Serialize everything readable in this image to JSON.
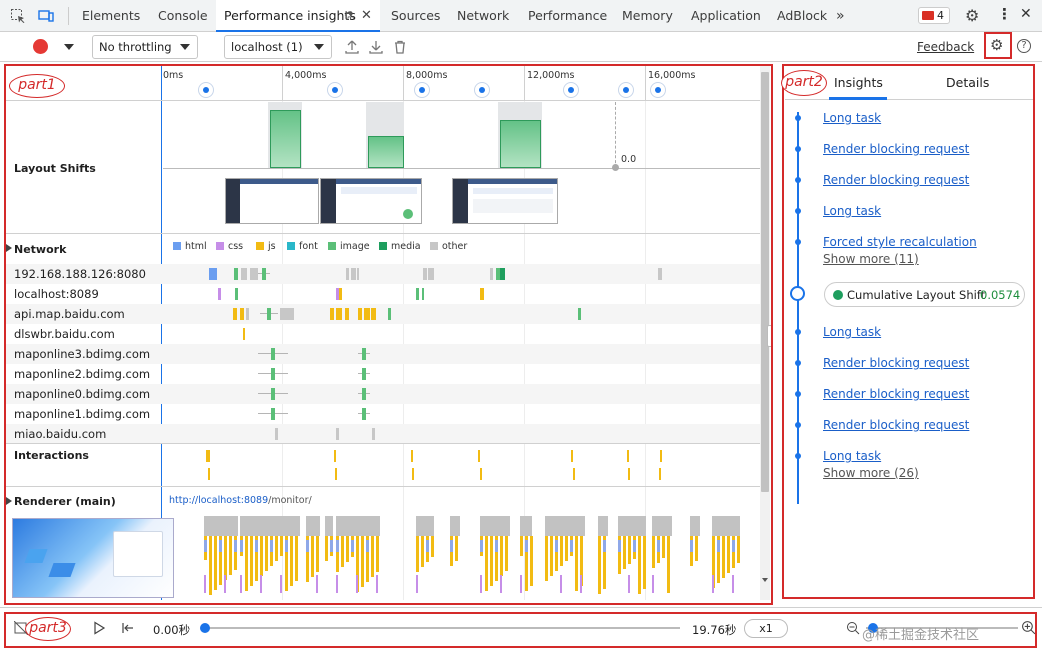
{
  "tabbar": {
    "tabs": [
      {
        "label": "Elements"
      },
      {
        "label": "Console"
      },
      {
        "label": "Performance insights"
      },
      {
        "label": "Sources"
      },
      {
        "label": "Network"
      },
      {
        "label": "Performance"
      },
      {
        "label": "Memory"
      },
      {
        "label": "Application"
      },
      {
        "label": "AdBlock"
      }
    ],
    "issues_count": "4",
    "active_tab_color": "#1a73e8"
  },
  "toolbar": {
    "throttling": "No throttling",
    "target": "localhost (1)",
    "feedback": "Feedback"
  },
  "annotations": {
    "part1": "part1",
    "part2": "part2",
    "part3": "part3",
    "color": "#d42a2a"
  },
  "timeline": {
    "ticks": [
      "0ms",
      "4,000ms",
      "8,000ms",
      "12,000ms",
      "16,000ms"
    ],
    "layout_shifts_label": "Layout Shifts",
    "layout_shift_value": "0.0",
    "network_label": "Network",
    "legend": [
      {
        "name": "html",
        "color": "#6b9ef0"
      },
      {
        "name": "css",
        "color": "#c68ee8"
      },
      {
        "name": "js",
        "color": "#f2bb13"
      },
      {
        "name": "font",
        "color": "#2ab7c9"
      },
      {
        "name": "image",
        "color": "#5bbf78"
      },
      {
        "name": "media",
        "color": "#1e9e5e"
      },
      {
        "name": "other",
        "color": "#c7c7c7"
      }
    ],
    "hosts": [
      "192.168.188.126:8080",
      "localhost:8089",
      "api.map.baidu.com",
      "dlswbr.baidu.com",
      "maponline3.bdimg.com",
      "maponline2.bdimg.com",
      "maponline0.bdimg.com",
      "maponline1.bdimg.com",
      "miao.baidu.com"
    ],
    "interactions_label": "Interactions",
    "renderer_label": "Renderer (main)",
    "renderer_url_host": "http://localhost:8089",
    "renderer_url_path": "/monitor/"
  },
  "sidepanel": {
    "tabs": [
      {
        "label": "Insights"
      },
      {
        "label": "Details"
      }
    ],
    "insights": [
      "Long task",
      "Render blocking request",
      "Render blocking request",
      "Long task",
      "Forced style recalculation"
    ],
    "show_more_1": "Show more (11)",
    "cls_label": "Cumulative Layout Shift",
    "cls_value": "0.0574",
    "insights2": [
      "Long task",
      "Render blocking request",
      "Render blocking request",
      "Render blocking request",
      "Long task"
    ],
    "show_more_2": "Show more (26)"
  },
  "player": {
    "start_time": "0.00秒",
    "end_time": "19.76秒",
    "speed": "x1",
    "watermark": "@稀土掘金技术社区",
    "progress": 0
  }
}
